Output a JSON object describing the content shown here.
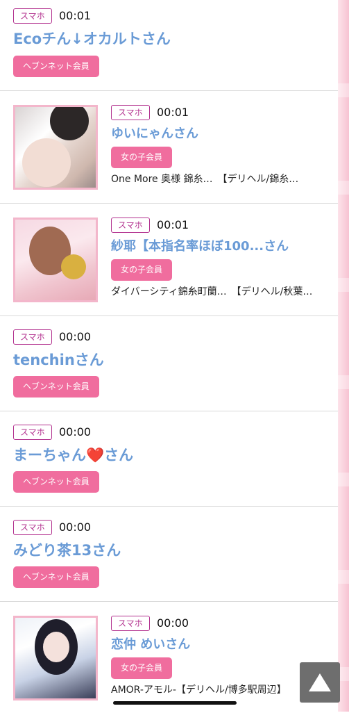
{
  "colors": {
    "badge_border": "#b2308e",
    "name_text": "#6a9bd6",
    "member_bg": "#f06d9e",
    "side_stripe": "#f7c3d2"
  },
  "entries": [
    {
      "device": "スマホ",
      "time": "00:01",
      "name": "Ecoチん↓オカルトさん",
      "member": "ヘブンネット会員"
    },
    {
      "device": "スマホ",
      "time": "00:01",
      "name": "ゆいにゃんさん",
      "member": "女の子会員",
      "shop": "One More 奥様 錦糸…　【デリヘル/錦糸…"
    },
    {
      "device": "スマホ",
      "time": "00:01",
      "name": "紗耶【本指名率ほぼ100...さん",
      "member": "女の子会員",
      "shop": "ダイバーシティ錦糸町蘭…　【デリヘル/秋葉…"
    },
    {
      "device": "スマホ",
      "time": "00:00",
      "name": "tenchinさん",
      "member": "ヘブンネット会員"
    },
    {
      "device": "スマホ",
      "time": "00:00",
      "name": "まーちゃん❤️さん",
      "member": "ヘブンネット会員"
    },
    {
      "device": "スマホ",
      "time": "00:00",
      "name": "みどり茶13さん",
      "member": "ヘブンネット会員"
    },
    {
      "device": "スマホ",
      "time": "00:00",
      "name": "恋仲 めいさん",
      "member": "女の子会員",
      "shop": "AMOR-アモル-【デリヘル/博多駅周辺】"
    }
  ],
  "icons": {
    "scroll_top": "up-triangle-icon"
  }
}
